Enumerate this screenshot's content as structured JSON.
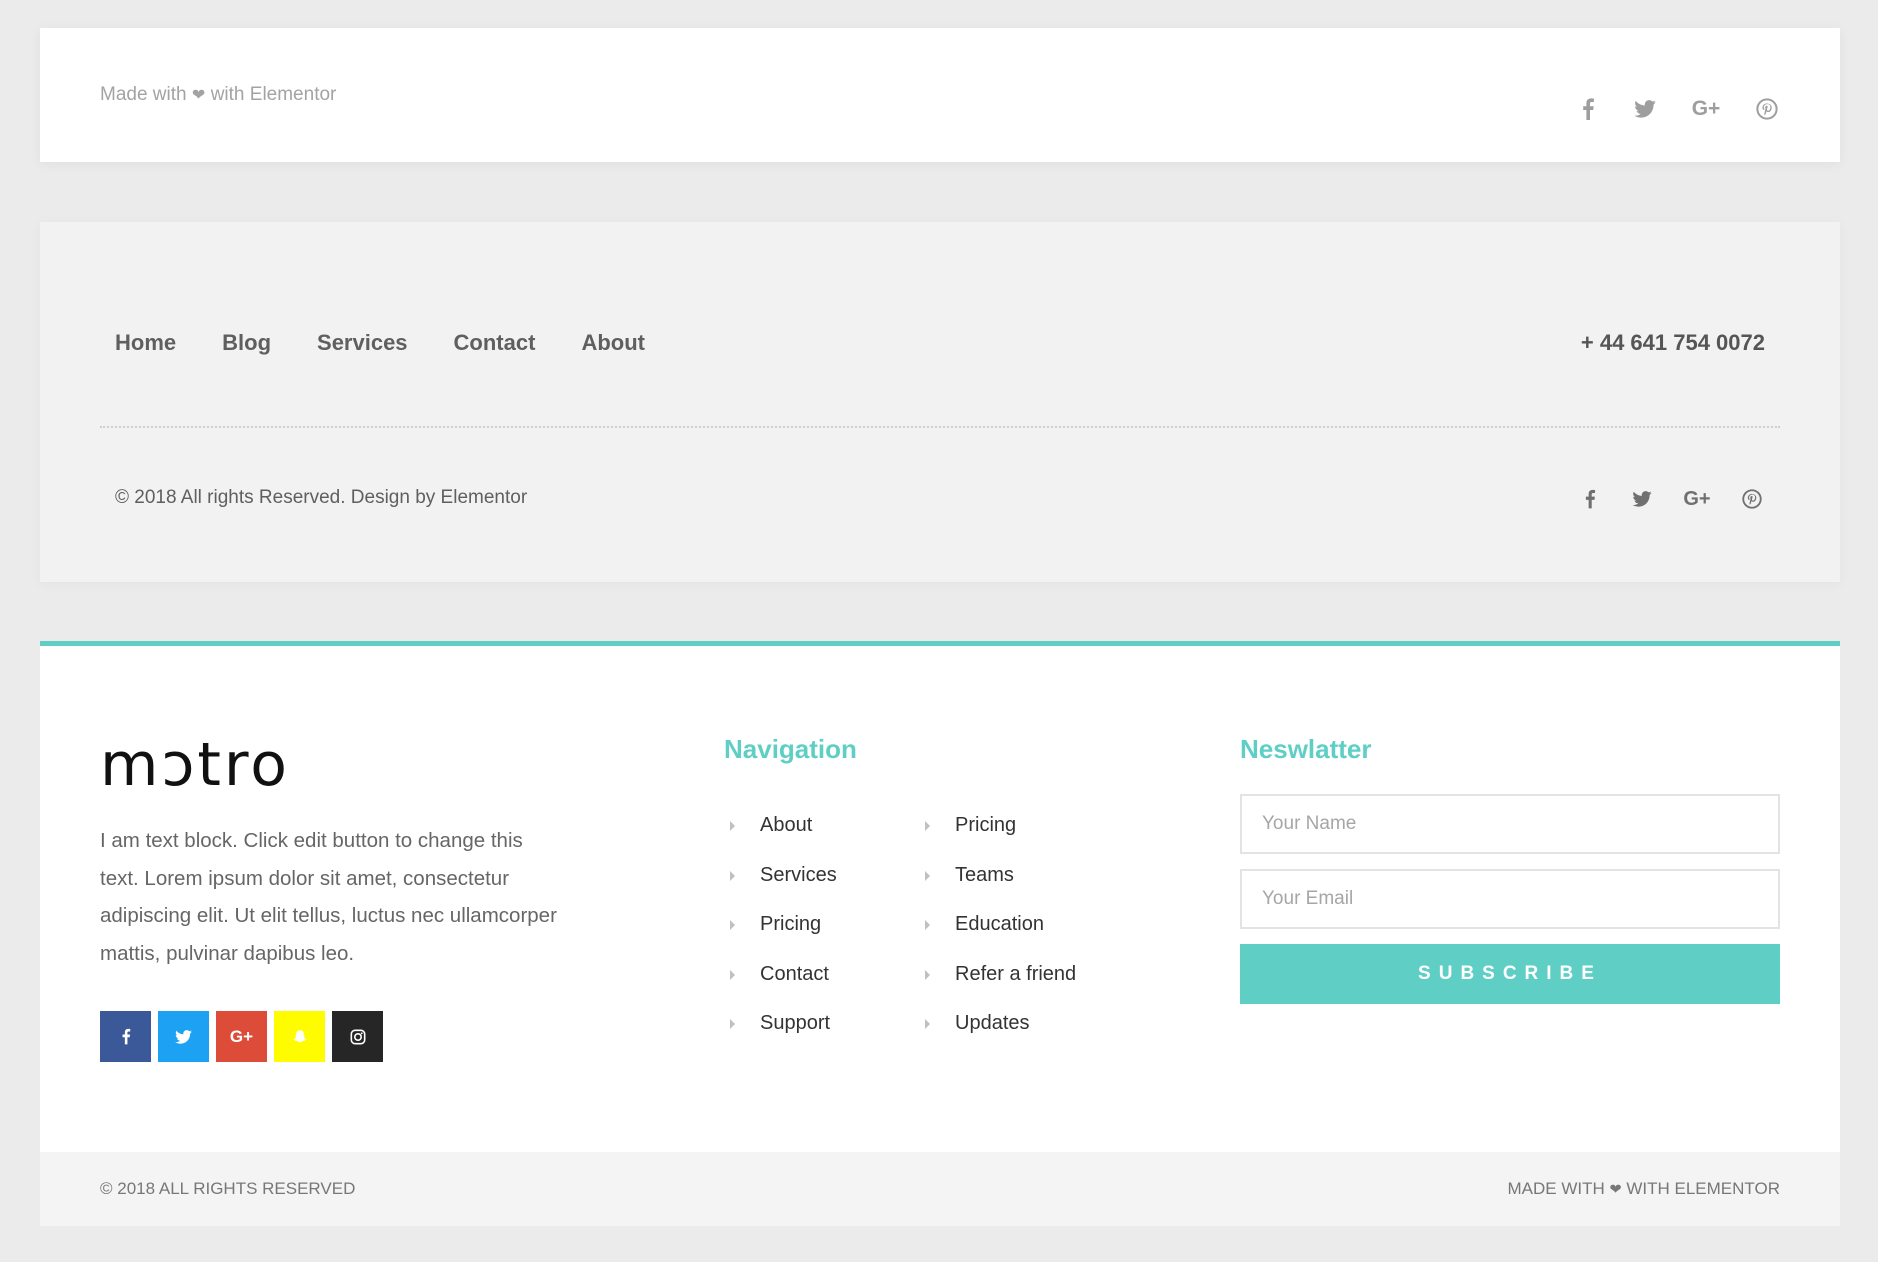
{
  "footer1": {
    "credit_before": "Made with",
    "heart": "❤",
    "credit_after": "with Elementor",
    "social": [
      "facebook-icon",
      "twitter-icon",
      "google-plus-icon",
      "pinterest-icon"
    ],
    "google_plus_label": "G+"
  },
  "footer2": {
    "nav": [
      "Home",
      "Blog",
      "Services",
      "Contact",
      "About"
    ],
    "phone": "+ 44 641 754 0072",
    "copyright": "© 2018 All rights Reserved. Design by Elementor",
    "social": [
      "facebook-icon",
      "twitter-icon",
      "google-plus-icon",
      "pinterest-icon"
    ],
    "google_plus_label": "G+"
  },
  "footer3": {
    "accent_color": "#5fcfc6",
    "logo": "mɔtro",
    "about_text": "I am text block. Click edit button to change this text. Lorem ipsum dolor sit amet, consectetur adipiscing elit. Ut elit tellus, luctus nec ullamcorper mattis, pulvinar dapibus leo.",
    "social_squares": [
      {
        "icon": "facebook-icon",
        "color": "#3b5998"
      },
      {
        "icon": "twitter-icon",
        "color": "#1da1f2"
      },
      {
        "icon": "google-plus-icon",
        "color": "#dd4b39",
        "label": "G+"
      },
      {
        "icon": "snapchat-icon",
        "color": "#fffc00"
      },
      {
        "icon": "instagram-icon",
        "color": "#262626"
      }
    ],
    "navigation_title": "Navigation",
    "nav_col1": [
      "About",
      "Services",
      "Pricing",
      "Contact",
      "Support"
    ],
    "nav_col2": [
      "Pricing",
      "Teams",
      "Education",
      "Refer a friend",
      "Updates"
    ],
    "newsletter_title": "Neswlatter",
    "name_placeholder": "Your Name",
    "email_placeholder": "Your Email",
    "subscribe_label": "SUBSCRIBE",
    "bottom_left": "© 2018 ALL RIGHTS RESERVED",
    "bottom_right_before": "MADE WITH",
    "bottom_right_after": "WITH ELEMENTOR"
  }
}
